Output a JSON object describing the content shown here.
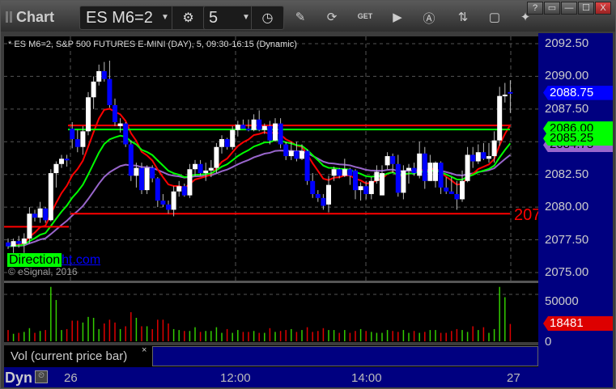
{
  "window": {
    "title": "Chart",
    "controls": [
      "?",
      "▭",
      "—",
      "☐",
      "X"
    ]
  },
  "toolbar": {
    "symbol": "ES M6=2",
    "interval": "5",
    "tools": [
      "pencil-icon",
      "refresh-icon",
      "get-icon",
      "play-icon",
      "alert-icon",
      "link-icon",
      "comment-icon",
      "twitter-icon"
    ]
  },
  "chart": {
    "legend": "* ES M6=2, S&P 500 FUTURES E-MINI (DAY), 5, 09:30-16:15 (Dynamic)",
    "copyright": "© eSignal, 2016",
    "logo": {
      "part1": "Direction",
      "part2": "ht.com"
    },
    "level_label": "207",
    "price_ticks": [
      "2092.50",
      "2090.00",
      "2087.50",
      "2082.50",
      "2080.00",
      "2077.50",
      "2075.00"
    ],
    "price_ticks_values": [
      2092.5,
      2090,
      2087.5,
      2082.5,
      2080,
      2077.5,
      2075
    ],
    "price_range": [
      2075,
      2092.5
    ],
    "tags": [
      {
        "value": "2084.75",
        "price": 2084.75,
        "color": "#9966cc",
        "text_color": "#000"
      },
      {
        "value": "2086.00",
        "price": 2086.0,
        "color": "#00ff00",
        "text_color": "#000"
      },
      {
        "value": "2085.25",
        "price": 2085.25,
        "color": "#00ff00",
        "text_color": "#000"
      },
      {
        "value": "2088.75",
        "price": 2088.75,
        "color": "#0000ff",
        "text_color": "#fff"
      }
    ],
    "horizontal_lines": [
      {
        "price": 2086.0,
        "color": "#ff0000"
      },
      {
        "price": 2079.5,
        "color": "#ff0000"
      },
      {
        "price": 2086.0,
        "color": "#00ff00"
      }
    ],
    "colors": {
      "up": "#ffffff",
      "down": "#0000ff",
      "ma_fast": "#ff0000",
      "ma_mid": "#00ff00",
      "ma_slow": "#9966cc"
    },
    "candles": [
      [
        2077.3,
        2077.6,
        2076.8,
        2077.0
      ],
      [
        2077.0,
        2077.6,
        2076.5,
        2077.4
      ],
      [
        2077.4,
        2077.8,
        2076.9,
        2077.2
      ],
      [
        2077.2,
        2078.0,
        2076.5,
        2077.6
      ],
      [
        2077.6,
        2080.0,
        2077.2,
        2079.5
      ],
      [
        2079.5,
        2079.8,
        2078.9,
        2079.2
      ],
      [
        2079.2,
        2080.4,
        2078.8,
        2079.9
      ],
      [
        2079.9,
        2080.0,
        2078.8,
        2079.0
      ],
      [
        2079.0,
        2082.9,
        2078.9,
        2082.6
      ],
      [
        2082.6,
        2083.5,
        2081.5,
        2083.3
      ],
      [
        2083.3,
        2084.0,
        2083.0,
        2083.7
      ],
      [
        2083.7,
        2084.0,
        2083.1,
        2083.6
      ],
      [
        2086.0,
        2086.5,
        2084.5,
        2085.2
      ],
      [
        2085.2,
        2085.9,
        2084.2,
        2084.6
      ],
      [
        2084.6,
        2086.2,
        2084.0,
        2085.8
      ],
      [
        2085.8,
        2088.8,
        2085.5,
        2088.4
      ],
      [
        2088.4,
        2090.0,
        2087.5,
        2089.6
      ],
      [
        2089.6,
        2090.9,
        2089.3,
        2090.4
      ],
      [
        2090.4,
        2091.1,
        2089.6,
        2089.8
      ],
      [
        2089.8,
        2091.2,
        2087.6,
        2087.8
      ],
      [
        2087.8,
        2088.3,
        2086.2,
        2086.5
      ],
      [
        2086.2,
        2086.8,
        2085.7,
        2086.4
      ],
      [
        2086.4,
        2086.5,
        2084.6,
        2084.8
      ],
      [
        2084.8,
        2085.1,
        2082.0,
        2082.4
      ],
      [
        2082.4,
        2083.4,
        2081.5,
        2083.0
      ],
      [
        2083.0,
        2083.4,
        2081.0,
        2081.3
      ],
      [
        2081.3,
        2083.2,
        2081.0,
        2083.0
      ],
      [
        2083.0,
        2083.2,
        2081.9,
        2082.2
      ],
      [
        2082.2,
        2082.3,
        2080.0,
        2080.5
      ],
      [
        2080.5,
        2081.0,
        2080.0,
        2080.2
      ],
      [
        2080.2,
        2080.5,
        2079.5,
        2079.8
      ],
      [
        2079.8,
        2081.6,
        2079.3,
        2081.2
      ],
      [
        2081.2,
        2082.0,
        2080.8,
        2081.6
      ],
      [
        2081.6,
        2081.8,
        2080.8,
        2080.9
      ],
      [
        2080.9,
        2083.3,
        2080.7,
        2082.9
      ],
      [
        2082.9,
        2083.6,
        2082.4,
        2083.3
      ],
      [
        2083.3,
        2083.6,
        2082.4,
        2082.6
      ],
      [
        2082.6,
        2083.4,
        2082.0,
        2082.8
      ],
      [
        2082.8,
        2083.6,
        2082.3,
        2083.0
      ],
      [
        2083.0,
        2084.9,
        2082.6,
        2084.6
      ],
      [
        2084.6,
        2085.5,
        2084.1,
        2085.2
      ],
      [
        2085.2,
        2085.3,
        2084.4,
        2084.6
      ],
      [
        2084.6,
        2086.2,
        2084.4,
        2085.9
      ],
      [
        2085.9,
        2086.6,
        2085.4,
        2086.3
      ],
      [
        2086.3,
        2086.7,
        2086.0,
        2086.0
      ],
      [
        2086.0,
        2086.7,
        2085.8,
        2085.9
      ],
      [
        2085.9,
        2087.1,
        2085.8,
        2086.7
      ],
      [
        2086.7,
        2087.4,
        2085.8,
        2085.9
      ],
      [
        2085.9,
        2086.4,
        2085.6,
        2086.2
      ],
      [
        2086.2,
        2086.6,
        2084.8,
        2085.1
      ],
      [
        2085.1,
        2086.8,
        2085.0,
        2086.4
      ],
      [
        2086.4,
        2086.8,
        2084.5,
        2084.8
      ],
      [
        2084.8,
        2085.0,
        2083.6,
        2083.9
      ],
      [
        2083.9,
        2085.0,
        2083.6,
        2084.3
      ],
      [
        2084.3,
        2085.0,
        2083.5,
        2083.7
      ],
      [
        2083.7,
        2084.8,
        2083.6,
        2084.3
      ],
      [
        2084.3,
        2084.4,
        2081.7,
        2082.0
      ],
      [
        2082.0,
        2082.6,
        2080.7,
        2081.0
      ],
      [
        2081.0,
        2081.3,
        2080.4,
        2080.7
      ],
      [
        2080.7,
        2081.0,
        2079.8,
        2080.1
      ],
      [
        2080.2,
        2082.4,
        2079.6,
        2081.7
      ],
      [
        2082.4,
        2083.1,
        2082.0,
        2082.9
      ],
      [
        2082.9,
        2083.0,
        2082.2,
        2082.4
      ],
      [
        2082.4,
        2083.7,
        2082.3,
        2082.9
      ],
      [
        2082.9,
        2083.0,
        2081.7,
        2082.4
      ],
      [
        2082.8,
        2082.9,
        2080.6,
        2081.3
      ],
      [
        2081.3,
        2081.9,
        2080.5,
        2081.6
      ],
      [
        2081.6,
        2082.0,
        2080.6,
        2081.0
      ],
      [
        2081.0,
        2082.3,
        2080.6,
        2082.0
      ],
      [
        2082.0,
        2083.2,
        2081.8,
        2082.7
      ],
      [
        2080.9,
        2083.2,
        2080.9,
        2082.6
      ],
      [
        2083.2,
        2084.2,
        2082.9,
        2083.9
      ],
      [
        2083.9,
        2084.1,
        2082.6,
        2083.3
      ],
      [
        2083.3,
        2084.0,
        2080.8,
        2081.1
      ],
      [
        2081.1,
        2083.2,
        2080.6,
        2082.8
      ],
      [
        2082.8,
        2083.3,
        2081.8,
        2083.0
      ],
      [
        2083.0,
        2083.4,
        2082.4,
        2082.6
      ],
      [
        2082.4,
        2085.0,
        2082.2,
        2084.1
      ],
      [
        2084.1,
        2084.6,
        2081.4,
        2082.0
      ],
      [
        2082.0,
        2084.0,
        2082.0,
        2083.4
      ],
      [
        2082.0,
        2083.5,
        2081.5,
        2083.4
      ],
      [
        2083.4,
        2083.5,
        2081.0,
        2081.5
      ],
      [
        2081.5,
        2082.3,
        2081.0,
        2081.2
      ],
      [
        2081.2,
        2082.3,
        2081.0,
        2081.0
      ],
      [
        2081.0,
        2082.0,
        2079.8,
        2080.6
      ],
      [
        2080.6,
        2082.8,
        2080.4,
        2082.0
      ],
      [
        2082.0,
        2084.6,
        2081.9,
        2084.0
      ],
      [
        2084.0,
        2084.6,
        2083.0,
        2083.5
      ],
      [
        2083.5,
        2084.8,
        2083.3,
        2084.2
      ],
      [
        2084.2,
        2084.9,
        2083.6,
        2083.7
      ],
      [
        2083.7,
        2084.9,
        2083.4,
        2083.9
      ],
      [
        2083.9,
        2085.8,
        2083.4,
        2085.1
      ],
      [
        2085.1,
        2089.2,
        2084.7,
        2088.5
      ],
      [
        2088.5,
        2089.5,
        2088.0,
        2088.6
      ],
      [
        2088.8,
        2089.7,
        2087.2,
        2088.7
      ]
    ]
  },
  "volume": {
    "label": "Vol (current price bar)",
    "close_label": "×",
    "ticks": [
      "50000",
      "0"
    ],
    "last": "18481",
    "last_color": "#dd0000",
    "max": 50000,
    "values": [
      12000,
      8000,
      9000,
      10000,
      14000,
      9000,
      11000,
      12000,
      58000,
      44000,
      12000,
      13000,
      22000,
      22000,
      20000,
      26000,
      25000,
      13000,
      19000,
      23000,
      20000,
      13000,
      16000,
      31000,
      25000,
      16000,
      16000,
      13000,
      23000,
      23000,
      19000,
      13000,
      12000,
      11000,
      11000,
      15000,
      10000,
      11000,
      11000,
      15000,
      9000,
      13000,
      9000,
      12000,
      10000,
      10000,
      11000,
      9000,
      9000,
      14000,
      10000,
      11000,
      12000,
      13000,
      10000,
      12000,
      15000,
      10000,
      11000,
      14000,
      12000,
      12000,
      9000,
      12000,
      9000,
      11000,
      13000,
      11000,
      10000,
      9000,
      9000,
      12000,
      11000,
      10000,
      12000,
      9000,
      11000,
      9000,
      10000,
      12000,
      12000,
      9000,
      9000,
      11000,
      13000,
      12000,
      10000,
      16000,
      12000,
      15000,
      9000,
      13000,
      58000,
      47000,
      18481
    ]
  },
  "time_axis": {
    "labels": [
      "26",
      "12:00",
      "14:00",
      "27"
    ],
    "dyn": "Dyn"
  }
}
